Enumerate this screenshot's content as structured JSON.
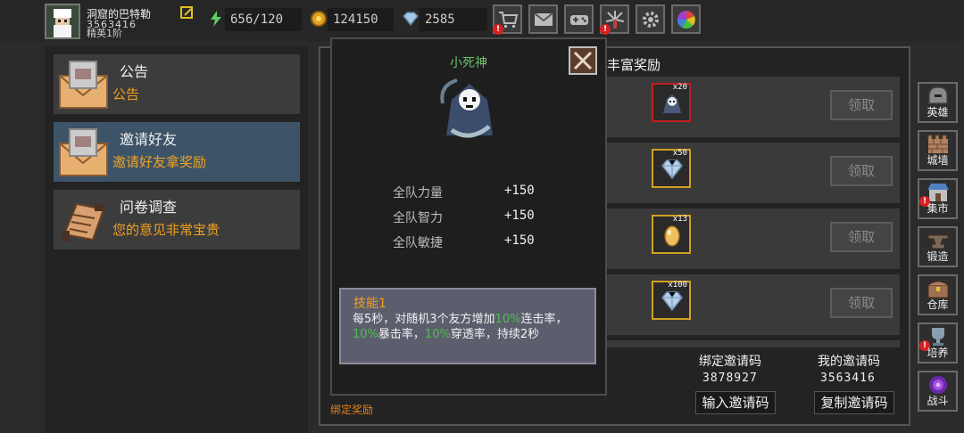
{
  "player": {
    "name": "洞窟的巴特勒",
    "id": "3563416",
    "rank": "精英1阶"
  },
  "resources": {
    "energy": "656/120",
    "gold": "124150",
    "gems": "2585"
  },
  "toolbar_icons": [
    "shop-icon",
    "mail-icon",
    "gamepad-icon",
    "firework-icon",
    "settings-icon",
    "color-wheel-icon"
  ],
  "left_list": [
    {
      "title": "公告",
      "subtitle": "公告"
    },
    {
      "title": "邀请好友",
      "subtitle": "邀请好友拿奖励"
    },
    {
      "title": "问卷调查",
      "subtitle": "您的意见非常宝贵"
    }
  ],
  "main": {
    "header_partial": "丰富奖励",
    "rewards": [
      {
        "count": "x20",
        "item_icon": "reaper-icon",
        "claim": "领取",
        "border": "#c02020"
      },
      {
        "count": "x50",
        "item_icon": "diamond-icon",
        "claim": "领取",
        "border": "#d0a020"
      },
      {
        "count": "x13",
        "item_icon": "egg-icon",
        "claim": "领取",
        "border": "#d0a020"
      },
      {
        "count": "x100",
        "item_icon": "diamond-icon",
        "claim": "领取",
        "border": "#d0a020"
      }
    ],
    "bind_code_label": "绑定邀请码",
    "bind_code_value": "3878927",
    "my_code_label": "我的邀请码",
    "my_code_value": "3563416",
    "input_code_button": "输入邀请码",
    "copy_code_button": "复制邀请码",
    "bind_reward": "绑定奖励"
  },
  "popup": {
    "title": "小死神",
    "stats": [
      {
        "label": "全队力量",
        "value": "+150"
      },
      {
        "label": "全队智力",
        "value": "+150"
      },
      {
        "label": "全队敏捷",
        "value": "+150"
      }
    ],
    "skill_title": "技能1",
    "skill_desc": {
      "p1": "每5秒，对随机3个友方增加",
      "v1": "10%",
      "p2": "连击率，",
      "v2": "10%",
      "p3": "暴击率，",
      "v3": "10%",
      "p4": "穿透率，持续2秒"
    }
  },
  "right_nav": [
    {
      "label": "英雄",
      "icon": "helmet-icon"
    },
    {
      "label": "城墙",
      "icon": "wall-icon"
    },
    {
      "label": "集市",
      "icon": "market-icon"
    },
    {
      "label": "锻造",
      "icon": "anvil-icon"
    },
    {
      "label": "仓库",
      "icon": "chest-icon"
    },
    {
      "label": "培养",
      "icon": "trophy-icon"
    },
    {
      "label": "战斗",
      "icon": "portal-icon"
    }
  ],
  "colors": {
    "accent_orange": "#f0a020",
    "highlight_green": "#4fbf4f",
    "selected_row": "#3d5468"
  }
}
